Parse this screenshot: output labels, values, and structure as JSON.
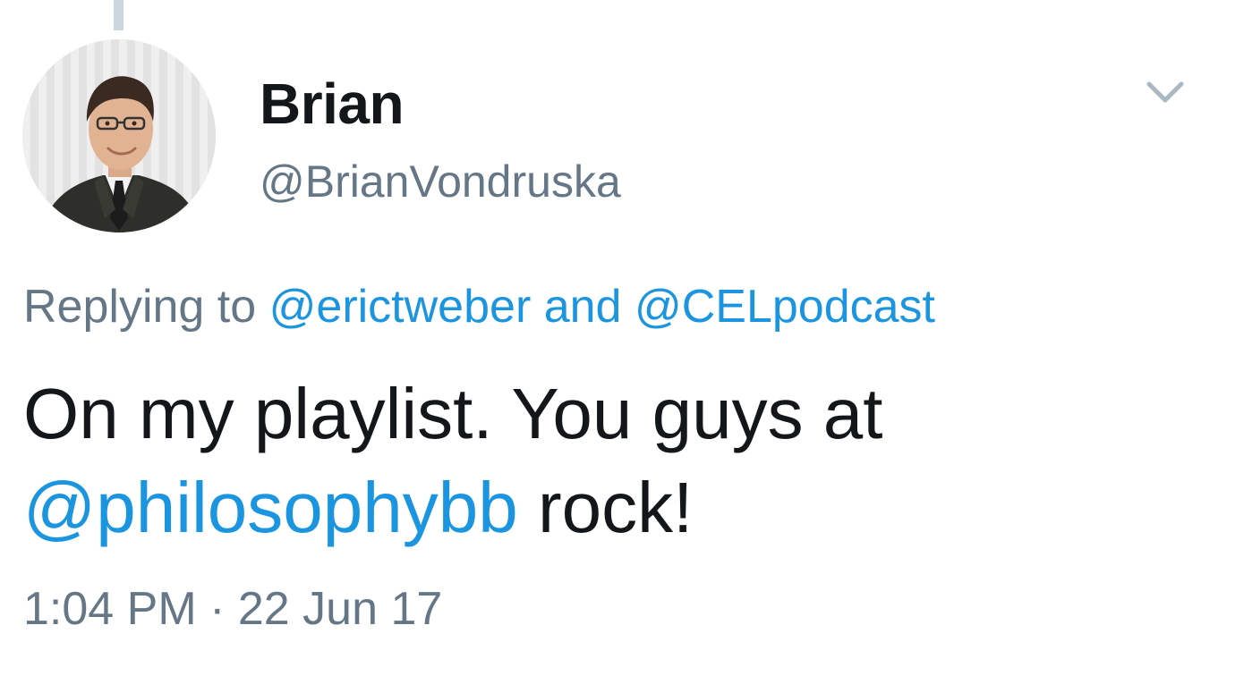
{
  "tweet": {
    "author": {
      "display_name": "Brian",
      "handle": "@BrianVondruska",
      "avatar_icon": "profile-photo-avatar"
    },
    "menu_icon": "chevron-down-icon",
    "reply_context": {
      "prefix": "Replying to",
      "mentions": [
        "@erictweber",
        "@CELpodcast"
      ],
      "joiner": "and"
    },
    "body": {
      "line1": "On my playlist. You guys at",
      "mention": "@philosophybb",
      "suffix": "rock!"
    },
    "timestamp": "1:04 PM · 22 Jun 17"
  },
  "colors": {
    "link": "#1b95e0",
    "secondary_text": "#657786",
    "primary_text": "#14171a",
    "thread_line": "#ccd6dd"
  }
}
